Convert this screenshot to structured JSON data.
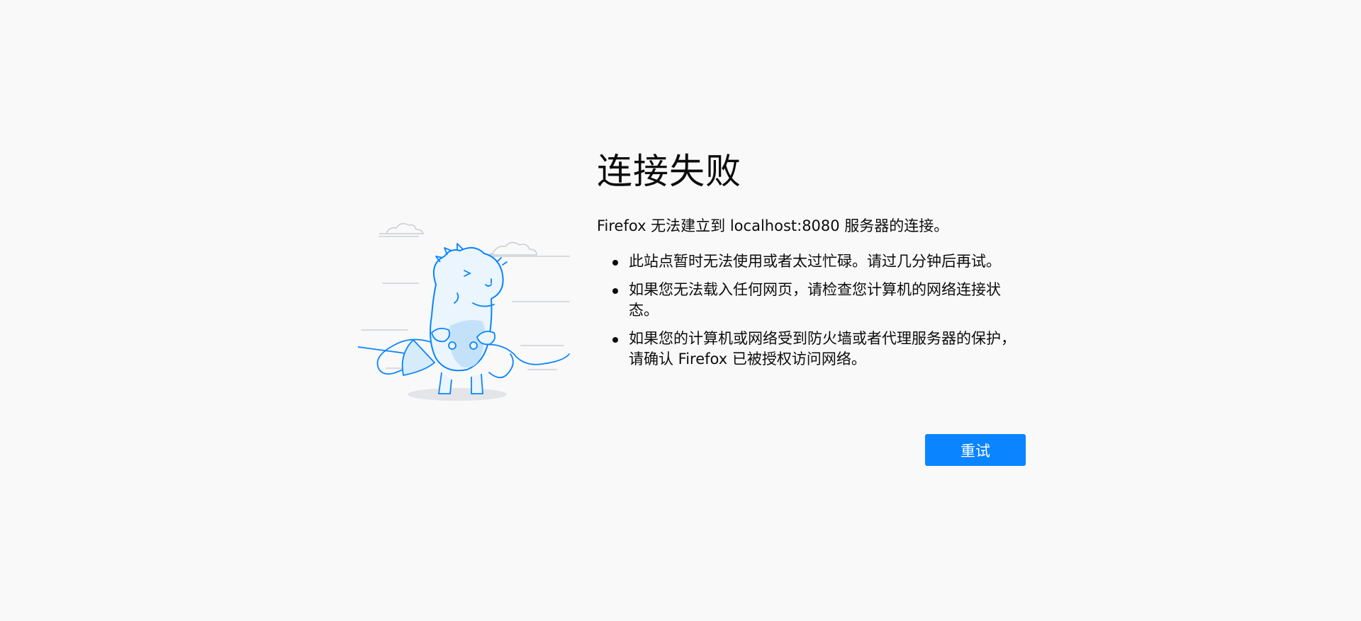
{
  "error": {
    "title": "连接失败",
    "description": "Firefox 无法建立到 localhost:8080 服务器的连接。",
    "reasons": [
      "此站点暂时无法使用或者太过忙碌。请过几分钟后再试。",
      "如果您无法载入任何网页，请检查您计算机的网络连接状态。",
      "如果您的计算机或网络受到防火墙或者代理服务器的保护，请确认 Firefox 已被授权访问网络。"
    ],
    "retry_label": "重试"
  },
  "illustration": {
    "icon": "unplugged-dinosaur-illustration",
    "accent_color": "#0a84ff",
    "fill_color": "#d6ecfb"
  },
  "colors": {
    "background": "#f9f9fa",
    "button": "#0a84ff",
    "text": "#0c0c0d"
  }
}
